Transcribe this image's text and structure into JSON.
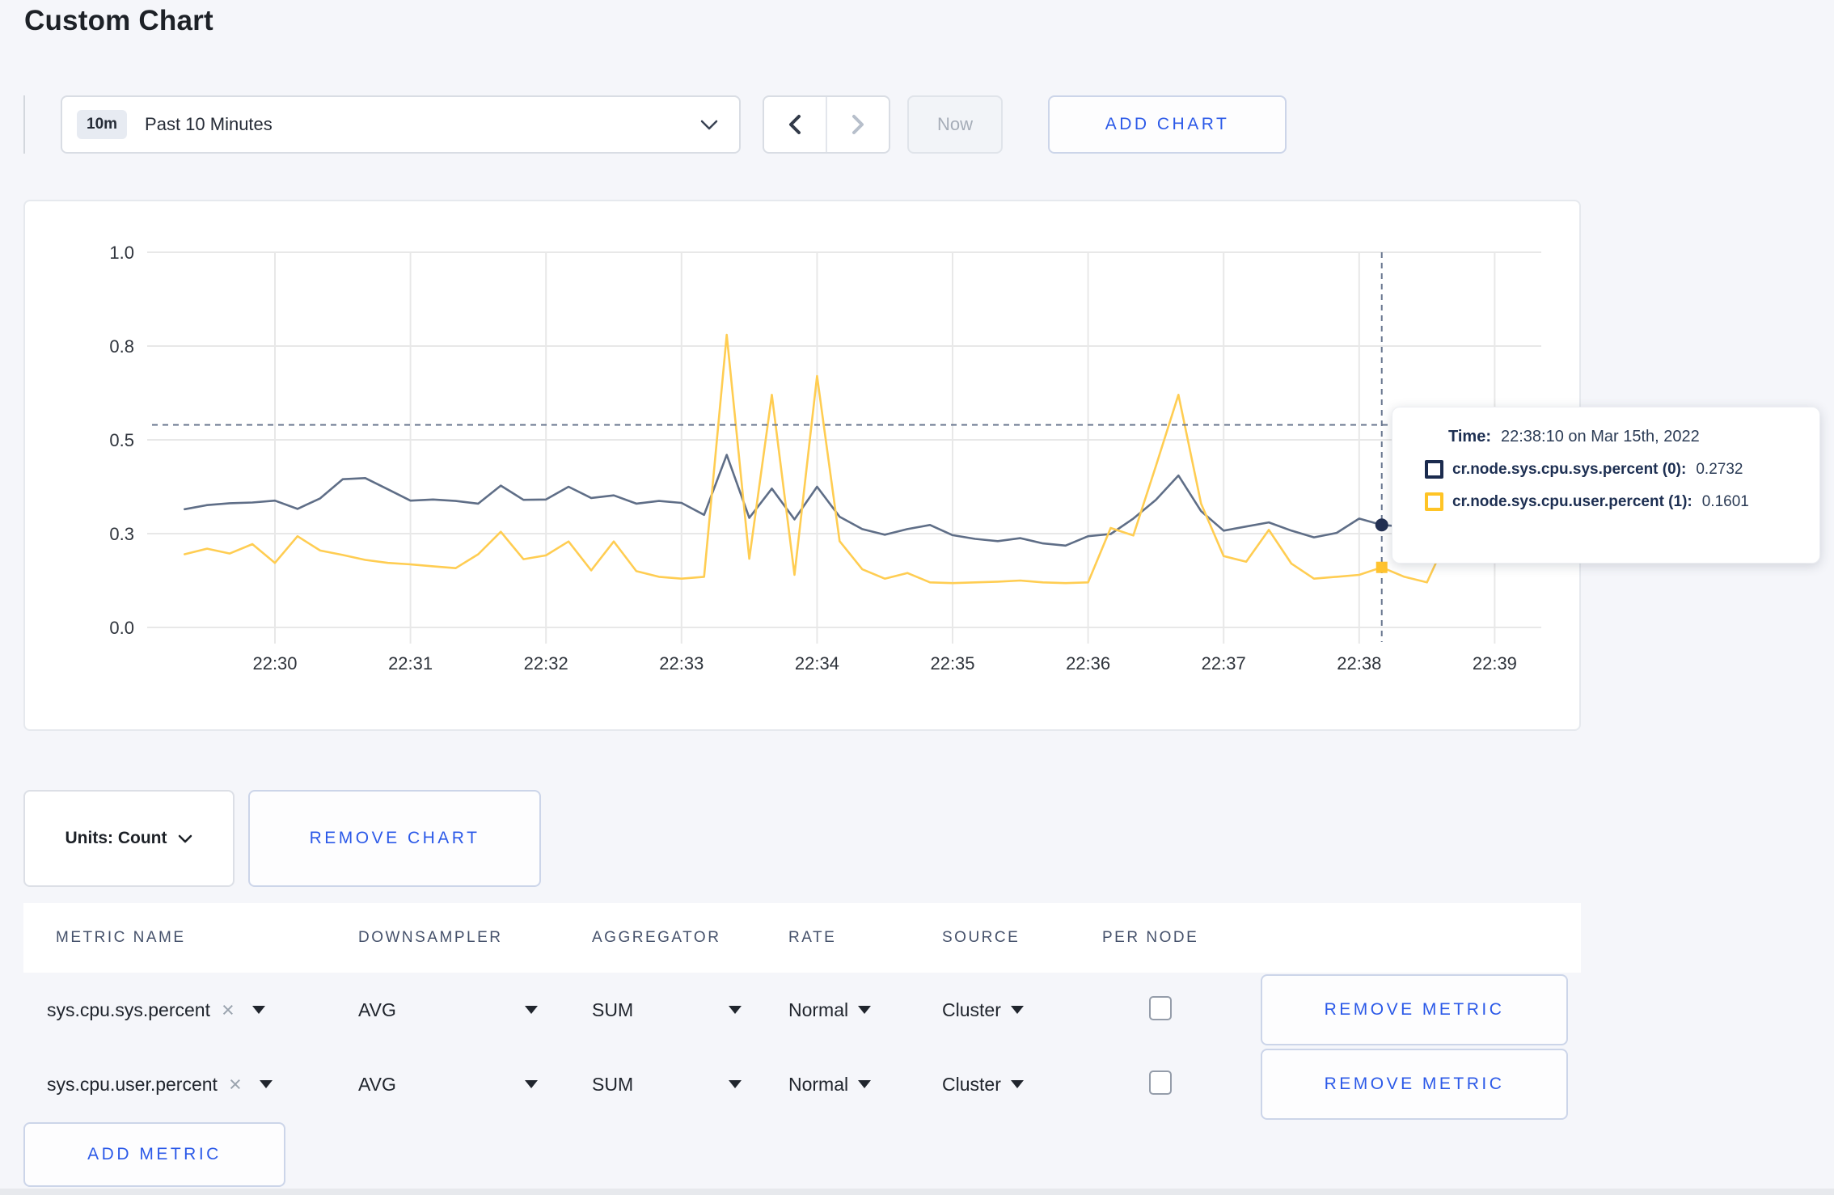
{
  "page": {
    "title": "Custom Chart"
  },
  "toolbar": {
    "time_badge": "10m",
    "time_label": "Past 10 Minutes",
    "now_label": "Now",
    "add_chart_label": "ADD CHART"
  },
  "chart_controls": {
    "units_label": "Units: Count",
    "remove_chart_label": "REMOVE CHART"
  },
  "tooltip": {
    "time_label": "Time:",
    "time_value": "22:38:10 on Mar 15th, 2022",
    "series": [
      {
        "name": "cr.node.sys.cpu.sys.percent (0):",
        "value": "0.2732",
        "color": "#1b2b4e"
      },
      {
        "name": "cr.node.sys.cpu.user.percent (1):",
        "value": "0.1601",
        "color": "#ffc425"
      }
    ]
  },
  "chart_data": {
    "type": "line",
    "title": "",
    "xlabel": "",
    "ylabel": "",
    "ylim": [
      0,
      1
    ],
    "grid": true,
    "legend_position": "none",
    "x_start": "22:29:20",
    "x_interval_seconds": 10,
    "x_tick_labels": [
      "22:30",
      "22:31",
      "22:32",
      "22:33",
      "22:34",
      "22:35",
      "22:36",
      "22:37",
      "22:38",
      "22:39"
    ],
    "y_ticks": [
      {
        "value": 0,
        "label": "0.0"
      },
      {
        "value": 0.25,
        "label": "0.3"
      },
      {
        "value": 0.5,
        "label": "0.5"
      },
      {
        "value": 0.75,
        "label": "0.8"
      },
      {
        "value": 1,
        "label": "1.0"
      }
    ],
    "cursor": {
      "time": "22:38:10",
      "index": 53,
      "crosshair_y": 0.54
    },
    "series": [
      {
        "name": "cr.node.sys.cpu.sys.percent (0)",
        "color": "#5f6e87",
        "marker": "circle",
        "marker_color": "#233052",
        "values": [
          0.315,
          0.326,
          0.331,
          0.333,
          0.338,
          0.316,
          0.344,
          0.395,
          0.398,
          0.368,
          0.338,
          0.341,
          0.337,
          0.33,
          0.378,
          0.34,
          0.341,
          0.375,
          0.345,
          0.352,
          0.33,
          0.337,
          0.332,
          0.3,
          0.46,
          0.292,
          0.37,
          0.288,
          0.375,
          0.295,
          0.262,
          0.247,
          0.262,
          0.273,
          0.246,
          0.236,
          0.23,
          0.238,
          0.224,
          0.218,
          0.243,
          0.249,
          0.29,
          0.34,
          0.405,
          0.31,
          0.258,
          0.269,
          0.28,
          0.258,
          0.24,
          0.252,
          0.29,
          0.2732,
          0.268,
          0.278,
          0.3,
          0.285,
          0.295,
          0.3
        ]
      },
      {
        "name": "cr.node.sys.cpu.user.percent (1)",
        "color": "#ffcd52",
        "marker": "square",
        "marker_color": "#ffc32f",
        "values": [
          0.195,
          0.21,
          0.197,
          0.222,
          0.172,
          0.243,
          0.205,
          0.193,
          0.18,
          0.172,
          0.168,
          0.163,
          0.158,
          0.195,
          0.255,
          0.182,
          0.192,
          0.229,
          0.152,
          0.229,
          0.15,
          0.135,
          0.13,
          0.135,
          0.78,
          0.183,
          0.62,
          0.14,
          0.67,
          0.23,
          0.155,
          0.13,
          0.145,
          0.12,
          0.118,
          0.12,
          0.122,
          0.125,
          0.12,
          0.118,
          0.12,
          0.265,
          0.245,
          0.43,
          0.62,
          0.33,
          0.19,
          0.175,
          0.26,
          0.17,
          0.13,
          0.135,
          0.14,
          0.1601,
          0.135,
          0.12,
          0.25,
          0.3,
          0.21,
          0.25
        ]
      }
    ]
  },
  "metrics_table": {
    "headers": [
      "METRIC NAME",
      "DOWNSAMPLER",
      "AGGREGATOR",
      "RATE",
      "SOURCE",
      "PER NODE"
    ],
    "rows": [
      {
        "name": "sys.cpu.sys.percent",
        "downsampler": "AVG",
        "aggregator": "SUM",
        "rate": "Normal",
        "source": "Cluster",
        "per_node_checked": false,
        "remove_label": "REMOVE METRIC"
      },
      {
        "name": "sys.cpu.user.percent",
        "downsampler": "AVG",
        "aggregator": "SUM",
        "rate": "Normal",
        "source": "Cluster",
        "per_node_checked": false,
        "remove_label": "REMOVE METRIC"
      }
    ],
    "add_metric_label": "ADD METRIC"
  },
  "colors": {
    "accent_blue": "#2b59e8",
    "series_sys": "#5f6e87",
    "series_user": "#ffcd52",
    "navy": "#1d2f52",
    "grid": "#e8e8e8",
    "crosshair": "#67758e",
    "page_bg": "#f5f6fa"
  }
}
